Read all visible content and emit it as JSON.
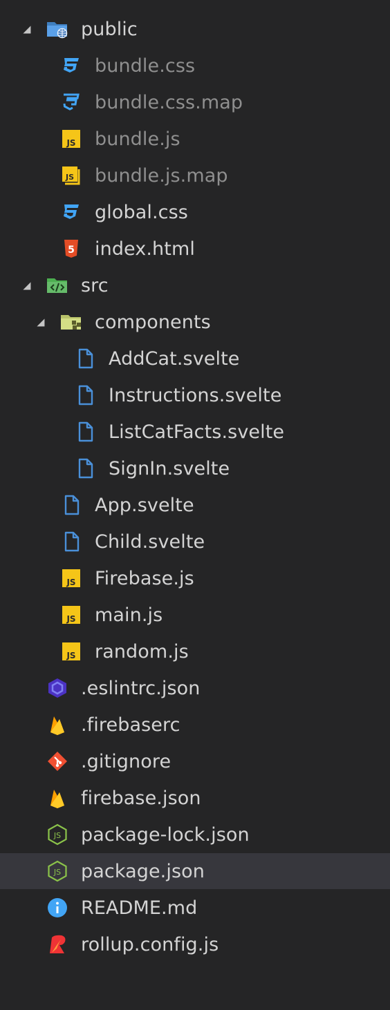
{
  "explorer": {
    "items": [
      {
        "label": "public",
        "depth": 0,
        "type": "folder",
        "expanded": true,
        "icon": "folder-public-icon"
      },
      {
        "label": "bundle.css",
        "depth": 1,
        "type": "file",
        "muted": true,
        "icon": "css-icon"
      },
      {
        "label": "bundle.css.map",
        "depth": 1,
        "type": "file",
        "muted": true,
        "icon": "css-map-icon"
      },
      {
        "label": "bundle.js",
        "depth": 1,
        "type": "file",
        "muted": true,
        "icon": "js-icon"
      },
      {
        "label": "bundle.js.map",
        "depth": 1,
        "type": "file",
        "muted": true,
        "icon": "js-map-icon"
      },
      {
        "label": "global.css",
        "depth": 1,
        "type": "file",
        "icon": "css-icon"
      },
      {
        "label": "index.html",
        "depth": 1,
        "type": "file",
        "icon": "html5-icon"
      },
      {
        "label": "src",
        "depth": 0,
        "type": "folder",
        "expanded": true,
        "icon": "folder-src-icon"
      },
      {
        "label": "components",
        "depth": 1,
        "type": "folder",
        "expanded": true,
        "icon": "folder-components-icon"
      },
      {
        "label": "AddCat.svelte",
        "depth": 2,
        "type": "file",
        "icon": "file-icon"
      },
      {
        "label": "Instructions.svelte",
        "depth": 2,
        "type": "file",
        "icon": "file-icon"
      },
      {
        "label": "ListCatFacts.svelte",
        "depth": 2,
        "type": "file",
        "icon": "file-icon"
      },
      {
        "label": "SignIn.svelte",
        "depth": 2,
        "type": "file",
        "icon": "file-icon"
      },
      {
        "label": "App.svelte",
        "depth": 1,
        "type": "file",
        "icon": "file-icon"
      },
      {
        "label": "Child.svelte",
        "depth": 1,
        "type": "file",
        "icon": "file-icon"
      },
      {
        "label": "Firebase.js",
        "depth": 1,
        "type": "file",
        "icon": "js-icon"
      },
      {
        "label": "main.js",
        "depth": 1,
        "type": "file",
        "icon": "js-icon"
      },
      {
        "label": "random.js",
        "depth": 1,
        "type": "file",
        "icon": "js-icon"
      },
      {
        "label": ".eslintrc.json",
        "depth": 0,
        "type": "file",
        "icon": "eslint-icon"
      },
      {
        "label": ".firebaserc",
        "depth": 0,
        "type": "file",
        "icon": "firebase-icon"
      },
      {
        "label": ".gitignore",
        "depth": 0,
        "type": "file",
        "icon": "git-icon"
      },
      {
        "label": "firebase.json",
        "depth": 0,
        "type": "file",
        "icon": "firebase-icon"
      },
      {
        "label": "package-lock.json",
        "depth": 0,
        "type": "file",
        "icon": "nodejs-icon"
      },
      {
        "label": "package.json",
        "depth": 0,
        "type": "file",
        "selected": true,
        "icon": "nodejs-icon"
      },
      {
        "label": "README.md",
        "depth": 0,
        "type": "file",
        "icon": "info-icon"
      },
      {
        "label": "rollup.config.js",
        "depth": 0,
        "type": "file",
        "icon": "rollup-icon"
      }
    ]
  },
  "colors": {
    "background": "#252526",
    "selected_row": "#37373d",
    "text": "#d4d4d4",
    "muted_text": "#8f8f8f",
    "css_blue": "#42a5f5",
    "js_yellow": "#f5c518",
    "html_orange": "#e44d26",
    "git_red": "#f05033",
    "node_green": "#8bc34a",
    "svelte_file_blue": "#4a90d9"
  }
}
